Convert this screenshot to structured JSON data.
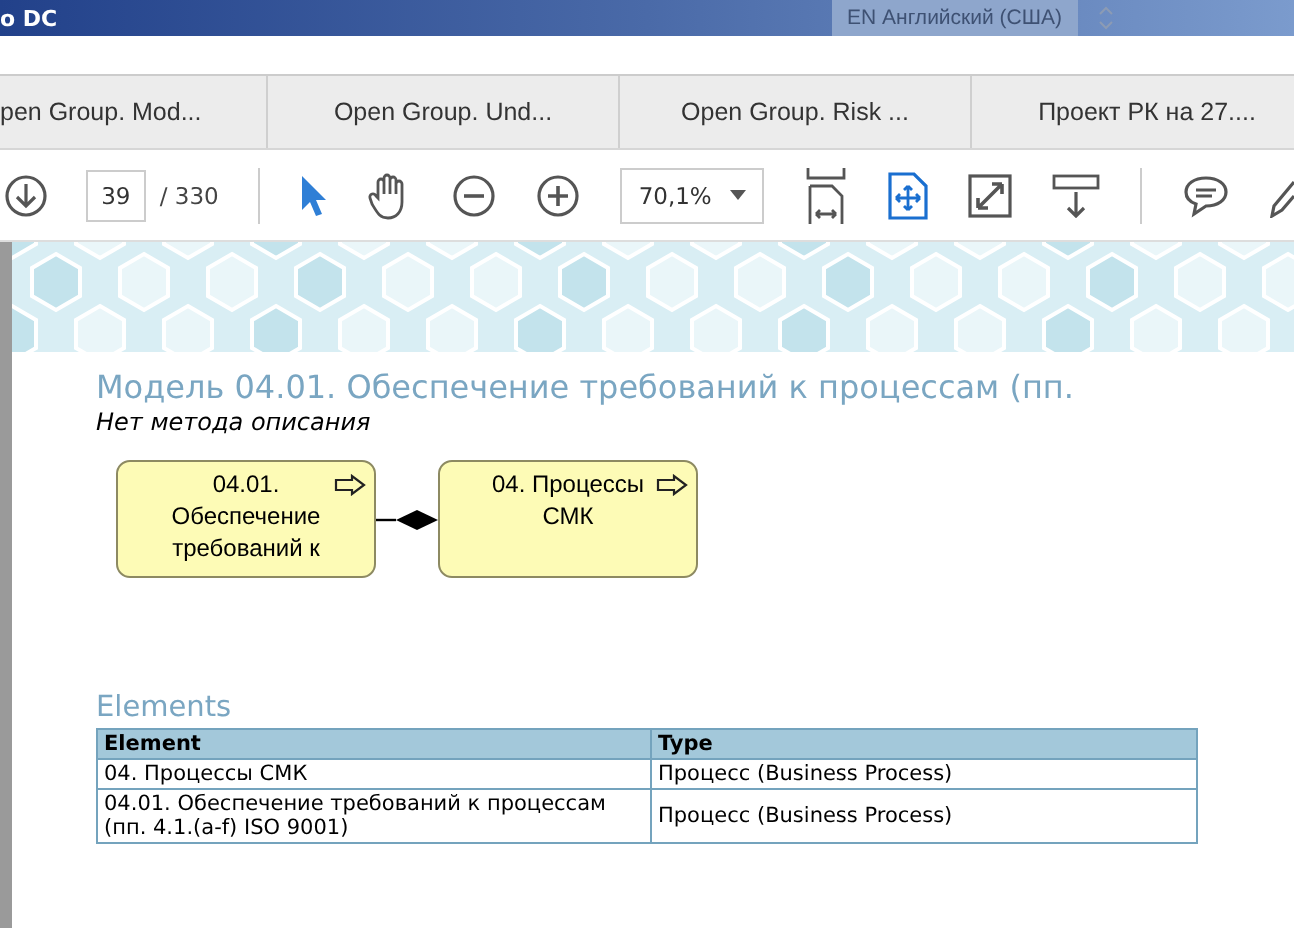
{
  "window": {
    "title": "o DC",
    "language": "EN Английский (США)"
  },
  "tabs": [
    {
      "label": "pen Group. Mod...",
      "selected": false
    },
    {
      "label": "Open Group. Und...",
      "selected": false
    },
    {
      "label": "Open Group. Risk ...",
      "selected": false
    },
    {
      "label": "Проект РК на 27....",
      "selected": false
    }
  ],
  "toolbar": {
    "page": "39",
    "page_total": "/ 330",
    "zoom": "70,1%"
  },
  "document": {
    "title": "Модель 04.01. Обеспечение требований к процессам (пп.",
    "subtitle": "Нет метода описания",
    "diagram": {
      "nodes": [
        {
          "label": "04.01. Обеспечение требований к"
        },
        {
          "label": "04. Процессы СМК"
        }
      ]
    },
    "elements_heading": "Elements",
    "table": {
      "columns": [
        "Element",
        "Type"
      ],
      "rows": [
        [
          "04. Процессы СМК",
          "Процесс (Business Process)"
        ],
        [
          "04.01. Обеспечение требований к процессам (пп. 4.1.(a-f) ISO 9001)",
          "Процесс (Business Process)"
        ]
      ]
    }
  }
}
